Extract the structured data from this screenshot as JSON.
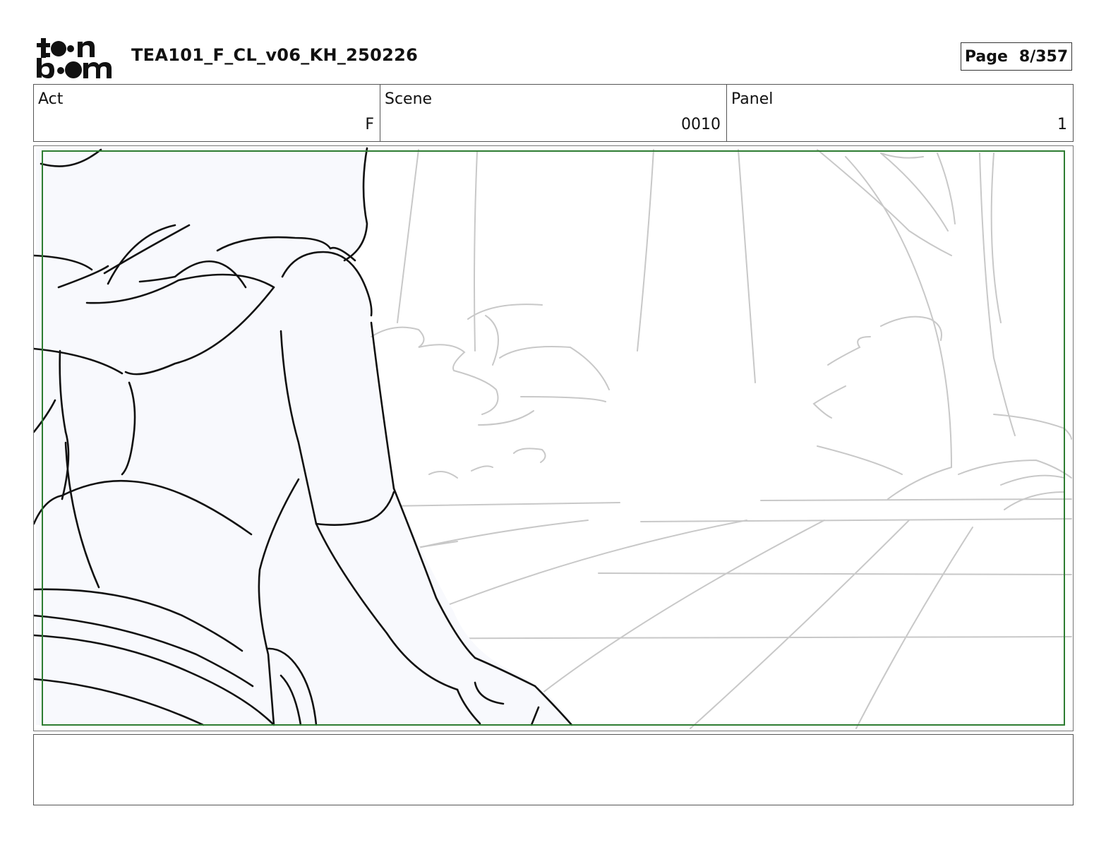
{
  "header": {
    "logo_text": "toon boom",
    "document_title": "TEA101_F_CL_v06_KH_250226",
    "page_label": "Page",
    "page_number": "8/357"
  },
  "info": {
    "act_label": "Act",
    "act_value": "F",
    "scene_label": "Scene",
    "scene_value": "0010",
    "panel_label": "Panel",
    "panel_value": "1"
  },
  "colors": {
    "safe_frame": "#2e7d32",
    "character_fill": "#f8f9fd",
    "background_lines": "#c8c8c8"
  },
  "caption": {
    "text": ""
  }
}
